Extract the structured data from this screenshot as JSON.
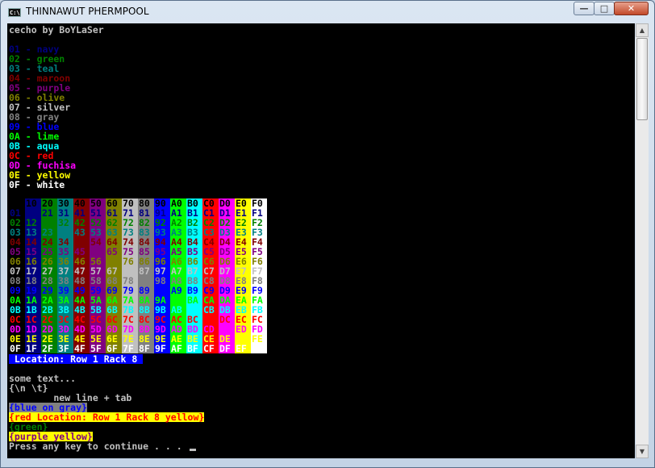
{
  "window": {
    "title": "THINNAWUT PHERMPOOL",
    "icon_text": "C:\\"
  },
  "controls": {
    "minimize": "—",
    "maximize": "□",
    "close": "✕"
  },
  "palette": [
    "#000000",
    "#000080",
    "#008000",
    "#008080",
    "#800000",
    "#800080",
    "#808000",
    "#c0c0c0",
    "#808080",
    "#0000ff",
    "#00ff00",
    "#00ffff",
    "#ff0000",
    "#ff00ff",
    "#ffff00",
    "#ffffff"
  ],
  "console": {
    "header": "cecho by BoYLaSer",
    "colors": [
      {
        "code": "01",
        "name": "navy"
      },
      {
        "code": "02",
        "name": "green"
      },
      {
        "code": "03",
        "name": "teal"
      },
      {
        "code": "04",
        "name": "maroon"
      },
      {
        "code": "05",
        "name": "purple"
      },
      {
        "code": "06",
        "name": "olive"
      },
      {
        "code": "07",
        "name": "silver"
      },
      {
        "code": "08",
        "name": "gray"
      },
      {
        "code": "09",
        "name": "blue"
      },
      {
        "code": "0A",
        "name": "lime"
      },
      {
        "code": "0B",
        "name": "aqua"
      },
      {
        "code": "0C",
        "name": "red"
      },
      {
        "code": "0D",
        "name": "fuchisa"
      },
      {
        "code": "0E",
        "name": "yellow"
      },
      {
        "code": "0F",
        "name": "white"
      }
    ],
    "location_label": " Location: Row 1 Rack 8 ",
    "some_text": "some text...",
    "escape_line": "{\\n \\t}",
    "newline_tab": "        new line + tab",
    "blue_on_gray": "{blue on gray}",
    "red_location": "{red Location: Row 1 Rack 8 yellow}",
    "green": "{green}",
    "purple_yellow": "{purple yellow}",
    "prompt": "Press any key to continue . . . "
  }
}
